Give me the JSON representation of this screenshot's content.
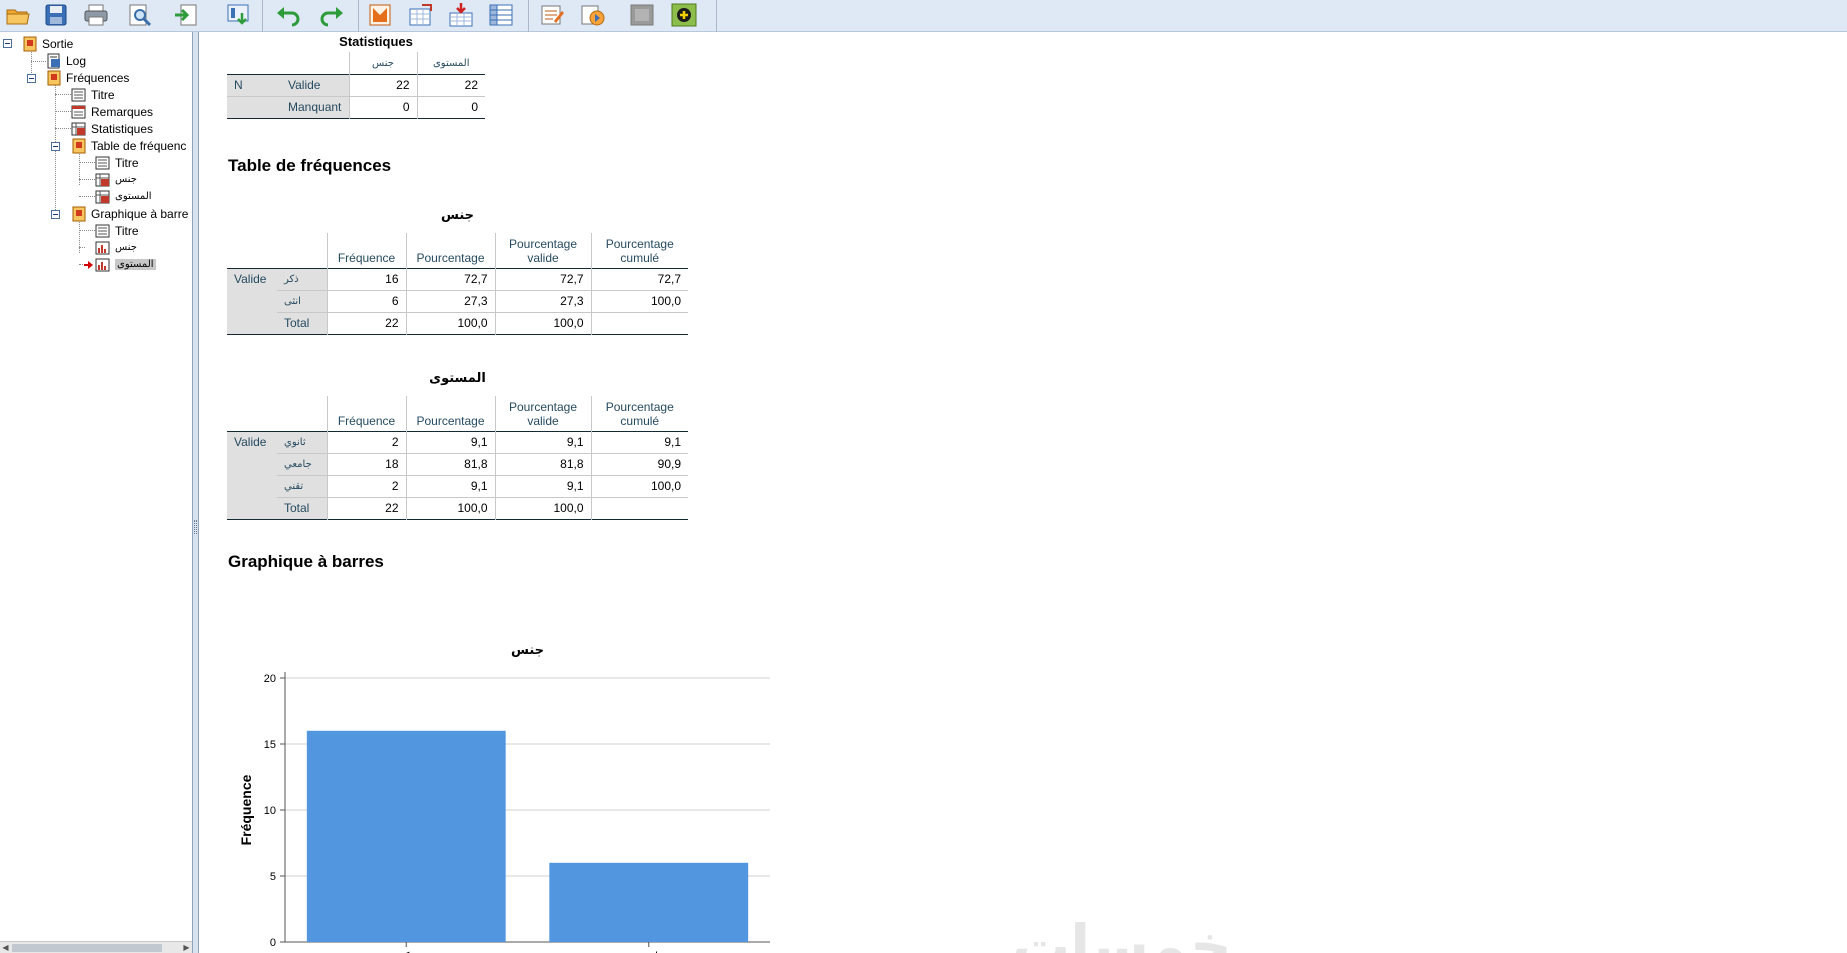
{
  "toolbar": {
    "icons": [
      "open-icon",
      "save-icon",
      "print-icon",
      "print-preview-icon",
      "export-icon",
      "recall-dialog-icon",
      "undo-icon",
      "redo-icon",
      "goto-data-icon",
      "goto-case-icon",
      "goto-variable-icon",
      "variables-icon",
      "designate-window-icon",
      "run-script-icon",
      "disabled-icon",
      "add-icon"
    ]
  },
  "navigator": {
    "items": [
      {
        "label": "Sortie"
      },
      {
        "label": "Log"
      },
      {
        "label": "Fréquences"
      },
      {
        "label": "Titre"
      },
      {
        "label": "Remarques"
      },
      {
        "label": "Statistiques"
      },
      {
        "label": "Table de fréquenc"
      },
      {
        "label": "Titre"
      },
      {
        "label": "جنس"
      },
      {
        "label": "المستوى"
      },
      {
        "label": "Graphique à barre"
      },
      {
        "label": "Titre"
      },
      {
        "label": "جنس"
      },
      {
        "label": "المستوى"
      }
    ]
  },
  "statistics": {
    "title": "Statistiques",
    "col_headers": [
      "جنس",
      "المستوى"
    ],
    "row_group": "N",
    "rows": [
      {
        "label": "Valide",
        "values": [
          "22",
          "22"
        ]
      },
      {
        "label": "Manquant",
        "values": [
          "0",
          "0"
        ]
      }
    ]
  },
  "freq_heading": "Table de fréquences",
  "freq_headers": {
    "freq": "Fréquence",
    "pct": "Pourcentage",
    "valid1": "Pourcentage",
    "valid2": "valide",
    "cum1": "Pourcentage",
    "cum2": "cumulé"
  },
  "freq_table_1": {
    "title": "جنس",
    "group": "Valide",
    "rows": [
      {
        "label": "ذكر",
        "freq": "16",
        "pct": "72,7",
        "valid": "72,7",
        "cum": "72,7"
      },
      {
        "label": "انثى",
        "freq": "6",
        "pct": "27,3",
        "valid": "27,3",
        "cum": "100,0"
      },
      {
        "label": "Total",
        "freq": "22",
        "pct": "100,0",
        "valid": "100,0",
        "cum": ""
      }
    ]
  },
  "freq_table_2": {
    "title": "المستوى",
    "group": "Valide",
    "rows": [
      {
        "label": "ثانوي",
        "freq": "2",
        "pct": "9,1",
        "valid": "9,1",
        "cum": "9,1"
      },
      {
        "label": "جامعي",
        "freq": "18",
        "pct": "81,8",
        "valid": "81,8",
        "cum": "90,9"
      },
      {
        "label": "تقني",
        "freq": "2",
        "pct": "9,1",
        "valid": "9,1",
        "cum": "100,0"
      },
      {
        "label": "Total",
        "freq": "22",
        "pct": "100,0",
        "valid": "100,0",
        "cum": ""
      }
    ]
  },
  "bar_heading": "Graphique à barres",
  "chart_data": {
    "type": "bar",
    "title": "جنس",
    "categories": [
      "ذكر",
      "انثى"
    ],
    "values": [
      16,
      6
    ],
    "xlabel": "",
    "ylabel": "Fréquence",
    "ylim": [
      0,
      20
    ],
    "yticks": [
      "0",
      "5",
      "10",
      "15",
      "20"
    ],
    "grid": true,
    "bar_color": "#5296e0"
  },
  "watermark": "خمسات",
  "colors": {
    "header_text": "#264a60",
    "row_label_bg": "#e0e0e0",
    "toolbar_bg": "#dfe9f5",
    "selection_bg": "#c8c8c8",
    "current_marker": "#d40000"
  }
}
